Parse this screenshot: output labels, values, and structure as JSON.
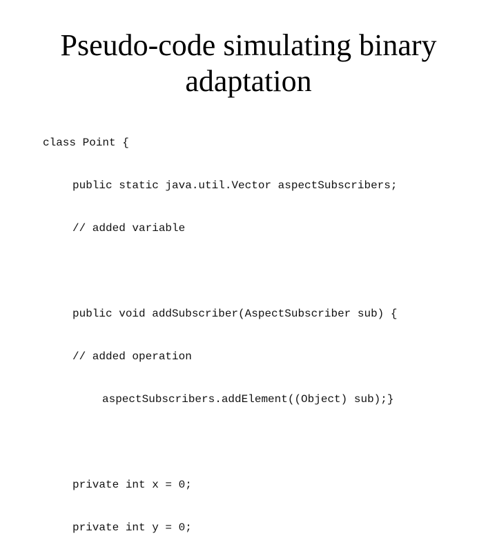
{
  "slide": {
    "title_lines": [
      "Pseudo-code simulating binary",
      "adaptation"
    ],
    "code": [
      {
        "indent": 0,
        "text": "class Point {"
      },
      {
        "indent": 1,
        "text": "public static java.util.Vector aspectSubscribers;"
      },
      {
        "indent": 1,
        "text": "// added variable"
      },
      {
        "indent": 1,
        "text": ""
      },
      {
        "indent": 1,
        "text": "public void addSubscriber(AspectSubscriber sub) {"
      },
      {
        "indent": 1,
        "text": "// added operation"
      },
      {
        "indent": 2,
        "text": "aspectSubscribers.addElement((Object) sub);}"
      },
      {
        "indent": 1,
        "text": ""
      },
      {
        "indent": 1,
        "text": "private int x = 0;"
      },
      {
        "indent": 1,
        "text": "private int y = 0;"
      }
    ]
  }
}
